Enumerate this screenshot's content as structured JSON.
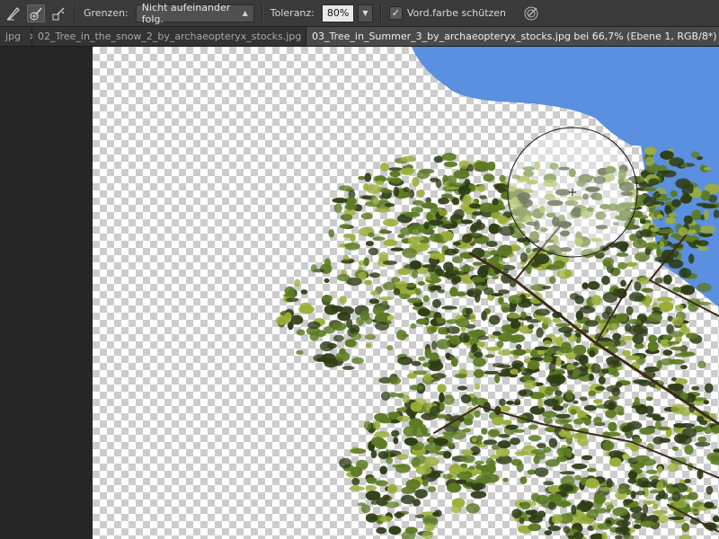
{
  "options_bar": {
    "tools": [
      {
        "icon": "eraser-icon"
      },
      {
        "icon": "background-eraser-icon",
        "active": true
      },
      {
        "icon": "magic-eraser-icon"
      }
    ],
    "limits_label": "Grenzen:",
    "limits_value": "Nicht aufeinander folg.",
    "tolerance_label": "Toleranz:",
    "tolerance_value": "80%",
    "protect_foreground_checked": true,
    "protect_foreground_check": "✓",
    "protect_foreground_label": "Vord.farbe schützen",
    "pressure_icon": "tablet-pressure-icon"
  },
  "tabs": [
    {
      "label": "jpg",
      "close": "×",
      "active": false
    },
    {
      "label": "02_Tree_in_the_snow_2_by_archaeopteryx_stocks.jpg",
      "close": "×",
      "active": false
    },
    {
      "label": "03_Tree_in_Summer_3_by_archaeopteryx_stocks.jpg bei 66,7% (Ebene 1, RGB/8*) *",
      "close": "×",
      "active": true
    }
  ],
  "colors": {
    "sky": "#5b8fe0",
    "foliage_dark": "#2e3d16",
    "foliage_mid": "#5b7a22",
    "foliage_light": "#9aae3a",
    "branch": "#3b2a18",
    "transparency_a": "#ffffff",
    "transparency_b": "#cccccc"
  },
  "brush_cursor": {
    "shape": "circle",
    "crosshair": true
  }
}
